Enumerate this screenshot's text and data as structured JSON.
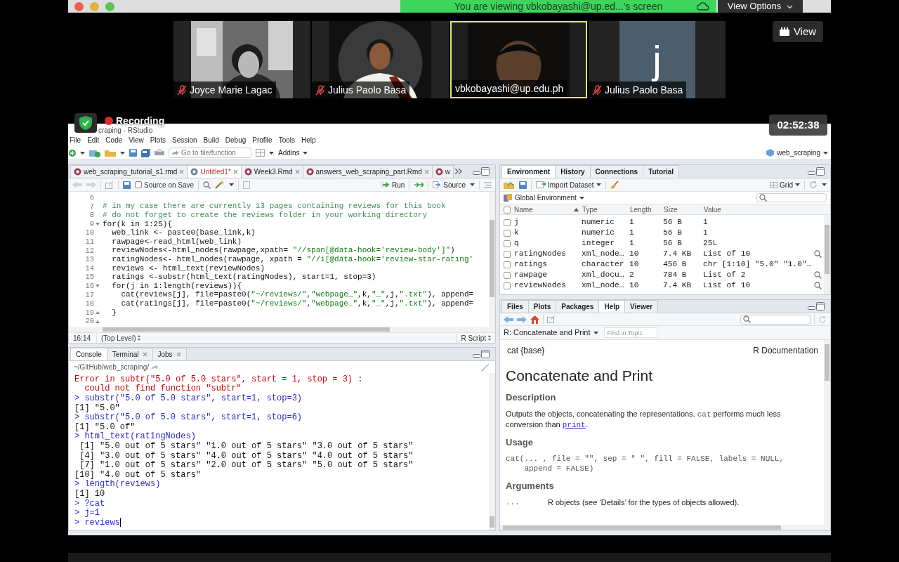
{
  "meeting": {
    "banner": "You are viewing vbkobayashi@up.ed...'s screen",
    "view_options": "View Options",
    "view_button": "View",
    "recording": "Recording",
    "timer": "02:52:38"
  },
  "participants": [
    {
      "name": "Joyce Marie Lagac",
      "muted": true,
      "active_speaker": false,
      "kind": "picture"
    },
    {
      "name": "Julius Paolo Basa",
      "muted": true,
      "active_speaker": false,
      "kind": "picture"
    },
    {
      "name": "vbkobayashi@up.edu.ph",
      "muted": false,
      "active_speaker": true,
      "kind": "picture"
    },
    {
      "name": "Julius Paolo Basa",
      "muted": true,
      "active_speaker": false,
      "kind": "avatar",
      "initial": "j"
    }
  ],
  "rstudio": {
    "title": "craping - RStudio",
    "menu": [
      "File",
      "Edit",
      "Code",
      "View",
      "Plots",
      "Session",
      "Build",
      "Debug",
      "Profile",
      "Tools",
      "Help"
    ],
    "toolbar": {
      "goto_placeholder": "Go to file/function",
      "addins": "Addins",
      "project": "web_scraping"
    },
    "editor": {
      "tabs": [
        {
          "label": "web_scraping_tutorial_s1.rmd",
          "selected": false,
          "closable": true
        },
        {
          "label": "Untitled1*",
          "selected": true,
          "closable": true
        },
        {
          "label": "Week3.Rmd",
          "selected": false,
          "closable": true
        },
        {
          "label": "answers_web_scraping_part.Rmd",
          "selected": false,
          "closable": true
        },
        {
          "label": "w",
          "selected": false,
          "closable": false
        }
      ],
      "source_on_save": {
        "label": "Source on Save",
        "checked": false
      },
      "run": "Run",
      "source": "Source",
      "lines": [
        {
          "number": "6",
          "fold_open": false,
          "fold_close": false
        },
        {
          "number": "7",
          "fold_open": false,
          "fold_close": false,
          "segments": [
            {
              "text": "# in my case there are currently 13 pages containing reviews for this book",
              "kind": "comment"
            }
          ]
        },
        {
          "number": "8",
          "fold_open": false,
          "fold_close": false,
          "segments": [
            {
              "text": "# do not forget to create the reviews folder in your working directory",
              "kind": "comment"
            }
          ]
        },
        {
          "number": "9",
          "fold_open": true,
          "fold_close": false,
          "segments": [
            {
              "text": "for(k in 1:25){",
              "kind": "code"
            }
          ]
        },
        {
          "number": "10",
          "fold_open": false,
          "fold_close": false,
          "segments": [
            {
              "text": "  web_link <- paste0(base_link,k)",
              "kind": "code"
            }
          ]
        },
        {
          "number": "11",
          "fold_open": false,
          "fold_close": false,
          "segments": [
            {
              "text": "  rawpage<-read_html(web_link)",
              "kind": "code"
            }
          ]
        },
        {
          "number": "12",
          "fold_open": false,
          "fold_close": false,
          "segments": [
            {
              "text": "  reviewNodes<-html_nodes(rawpage,xpath= ",
              "kind": "code"
            },
            {
              "text": "\"//span[@data-hook='review-body']\"",
              "kind": "string"
            },
            {
              "text": ")",
              "kind": "code"
            }
          ]
        },
        {
          "number": "13",
          "fold_open": false,
          "fold_close": false,
          "segments": [
            {
              "text": "  ratingNodes<- html_nodes(rawpage, xpath = ",
              "kind": "code"
            },
            {
              "text": "\"//i[@data-hook='review-star-rating'",
              "kind": "string"
            }
          ]
        },
        {
          "number": "14",
          "fold_open": false,
          "fold_close": false,
          "segments": [
            {
              "text": "  reviews <- html_text(reviewNodes)",
              "kind": "code"
            }
          ]
        },
        {
          "number": "15",
          "fold_open": false,
          "fold_close": false,
          "segments": [
            {
              "text": "  ratings <-substr(html_text(ratingNodes), start=1, stop=3)",
              "kind": "code"
            }
          ]
        },
        {
          "number": "16",
          "fold_open": true,
          "fold_close": false,
          "segments": [
            {
              "text": "  for(j in 1:length(reviews)){",
              "kind": "code"
            }
          ]
        },
        {
          "number": "17",
          "fold_open": false,
          "fold_close": false,
          "segments": [
            {
              "text": "    cat(reviews[j], file=paste0(",
              "kind": "code"
            },
            {
              "text": "\"~/reviews/\"",
              "kind": "string"
            },
            {
              "text": ",",
              "kind": "code"
            },
            {
              "text": "\"webpage_\"",
              "kind": "string"
            },
            {
              "text": ",k,",
              "kind": "code"
            },
            {
              "text": "\"_\"",
              "kind": "string"
            },
            {
              "text": ",j,",
              "kind": "code"
            },
            {
              "text": "\".txt\"",
              "kind": "string"
            },
            {
              "text": "), append=",
              "kind": "code"
            }
          ]
        },
        {
          "number": "18",
          "fold_open": false,
          "fold_close": false,
          "segments": [
            {
              "text": "    cat(ratings[j], file=paste0(",
              "kind": "code"
            },
            {
              "text": "\"~/reviews/\"",
              "kind": "string"
            },
            {
              "text": ",",
              "kind": "code"
            },
            {
              "text": "\"webpage_\"",
              "kind": "string"
            },
            {
              "text": ",k,",
              "kind": "code"
            },
            {
              "text": "\"_\"",
              "kind": "string"
            },
            {
              "text": ",j,",
              "kind": "code"
            },
            {
              "text": "\".txt\"",
              "kind": "string"
            },
            {
              "text": "), append=",
              "kind": "code"
            }
          ]
        },
        {
          "number": "19",
          "fold_open": false,
          "fold_close": true,
          "segments": [
            {
              "text": "  }",
              "kind": "code"
            }
          ]
        },
        {
          "number": "20",
          "fold_open": false,
          "fold_close": true
        }
      ],
      "status": {
        "position": "16:14",
        "scope": "(Top Level)",
        "file_type": "R Script"
      }
    },
    "console": {
      "tabs": [
        {
          "label": "Console",
          "selected": true,
          "closable": false
        },
        {
          "label": "Terminal",
          "selected": false,
          "closable": true
        },
        {
          "label": "Jobs",
          "selected": false,
          "closable": true
        }
      ],
      "path": "~/GitHub/web_scraping/",
      "lines": [
        {
          "kind": "error",
          "text": "Error in subtr(\"5.0 of 5.0 stars\", start = 1, stop = 3) :"
        },
        {
          "kind": "error",
          "text": "  could not find function \"subtr\""
        },
        {
          "kind": "input",
          "text": "> substr(\"5.0 of 5.0 stars\", start=1, stop=3)"
        },
        {
          "kind": "output",
          "text": "[1] \"5.0\""
        },
        {
          "kind": "input",
          "text": "> substr(\"5.0 of 5.0 stars\", start=1, stop=6)"
        },
        {
          "kind": "output",
          "text": "[1] \"5.0 of\""
        },
        {
          "kind": "input",
          "text": "> html_text(ratingNodes)"
        },
        {
          "kind": "output",
          "text": " [1] \"5.0 out of 5 stars\" \"1.0 out of 5 stars\" \"3.0 out of 5 stars\""
        },
        {
          "kind": "output",
          "text": " [4] \"3.0 out of 5 stars\" \"4.0 out of 5 stars\" \"4.0 out of 5 stars\""
        },
        {
          "kind": "output",
          "text": " [7] \"1.0 out of 5 stars\" \"2.0 out of 5 stars\" \"5.0 out of 5 stars\""
        },
        {
          "kind": "output",
          "text": "[10] \"4.0 out of 5 stars\""
        },
        {
          "kind": "input",
          "text": "> length(reviews)"
        },
        {
          "kind": "output",
          "text": "[1] 10"
        },
        {
          "kind": "input",
          "text": "> ?cat"
        },
        {
          "kind": "input",
          "text": "> j=1"
        },
        {
          "kind": "input",
          "text": "> reviews"
        }
      ]
    },
    "environment": {
      "tabs": [
        {
          "label": "Environment",
          "selected": true
        },
        {
          "label": "History",
          "selected": false
        },
        {
          "label": "Connections",
          "selected": false
        },
        {
          "label": "Tutorial",
          "selected": false
        }
      ],
      "import": "Import Dataset",
      "all_checked": false,
      "view_mode": "Grid",
      "scope": "Global Environment",
      "columns": [
        "Name",
        "Type",
        "Length",
        "Size",
        "Value"
      ],
      "rows": [
        {
          "name": "j",
          "type": "numeric",
          "length": "1",
          "size": "56 B",
          "value": "1",
          "checked": false,
          "viewable": false
        },
        {
          "name": "k",
          "type": "numeric",
          "length": "1",
          "size": "56 B",
          "value": "1",
          "checked": false,
          "viewable": false
        },
        {
          "name": "q",
          "type": "integer",
          "length": "1",
          "size": "56 B",
          "value": "25L",
          "checked": false,
          "viewable": false
        },
        {
          "name": "ratingNodes",
          "type": "xml_node…",
          "length": "10",
          "size": "7.4 KB",
          "value": "List of 10",
          "checked": false,
          "viewable": true
        },
        {
          "name": "ratings",
          "type": "character",
          "length": "10",
          "size": "456 B",
          "value": "chr [1:10] \"5.0\" \"1.0\"…",
          "checked": false,
          "viewable": false
        },
        {
          "name": "rawpage",
          "type": "xml_docu…",
          "length": "2",
          "size": "784 B",
          "value": "List of 2",
          "checked": false,
          "viewable": true
        },
        {
          "name": "reviewNodes",
          "type": "xml_node…",
          "length": "10",
          "size": "7.4 KB",
          "value": "List of 10",
          "checked": false,
          "viewable": true
        }
      ]
    },
    "help": {
      "tabs": [
        {
          "label": "Files",
          "selected": false
        },
        {
          "label": "Plots",
          "selected": false
        },
        {
          "label": "Packages",
          "selected": false
        },
        {
          "label": "Help",
          "selected": true
        },
        {
          "label": "Viewer",
          "selected": false
        }
      ],
      "topic": "R: Concatenate and Print",
      "find_placeholder": "Find in Topic",
      "package": "cat {base}",
      "doc_label": "R Documentation",
      "title": "Concatenate and Print",
      "sections": [
        {
          "kind": "heading",
          "text": "Description"
        },
        {
          "kind": "paragraph",
          "segments": [
            {
              "text": "Outputs the objects, concatenating the representations. ",
              "kind": "text"
            },
            {
              "text": "cat",
              "kind": "code"
            },
            {
              "text": " performs much less conversion than ",
              "kind": "text"
            },
            {
              "text": "print",
              "kind": "link"
            },
            {
              "text": ".",
              "kind": "text"
            }
          ]
        },
        {
          "kind": "heading",
          "text": "Usage"
        },
        {
          "kind": "code",
          "text": "cat(... , file = \"\", sep = \" \", fill = FALSE, labels = NULL,\n    append = FALSE)"
        },
        {
          "kind": "heading",
          "text": "Arguments"
        },
        {
          "kind": "argument",
          "name": "...",
          "text": "R objects (see ‘Details’ for the types of objects allowed)."
        }
      ]
    }
  }
}
